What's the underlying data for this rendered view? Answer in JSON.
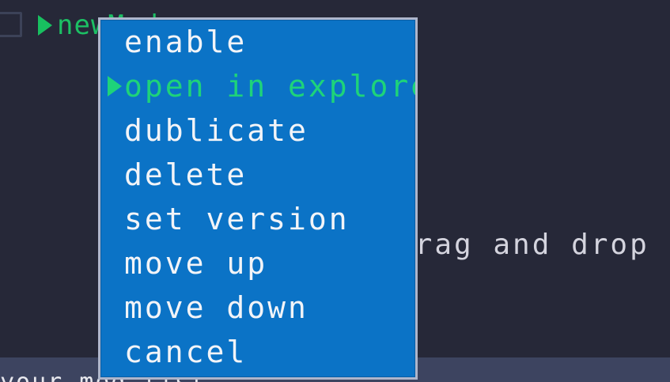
{
  "mod_list": {
    "items": [
      {
        "name": "newMod",
        "checked": false,
        "selected": true
      }
    ]
  },
  "drop_hint": "drag and drop zip",
  "bottom_bar": {
    "text": "your mod list"
  },
  "context_menu": {
    "selected_index": 1,
    "items": [
      {
        "label": "enable"
      },
      {
        "label": "open in explorer"
      },
      {
        "label": "dublicate"
      },
      {
        "label": "delete"
      },
      {
        "label": "set version"
      },
      {
        "label": "move up"
      },
      {
        "label": "move down"
      },
      {
        "label": "cancel"
      }
    ]
  },
  "colors": {
    "background": "#262838",
    "menu_background": "#0b73c6",
    "menu_border": "#aeb6cc",
    "accent_green": "#1ed37a",
    "text_light": "#f2f4f8",
    "bottom_bar": "#3d4460"
  },
  "icons": {
    "selection_pointer": "triangle-right-icon",
    "checkbox": "checkbox-icon"
  }
}
